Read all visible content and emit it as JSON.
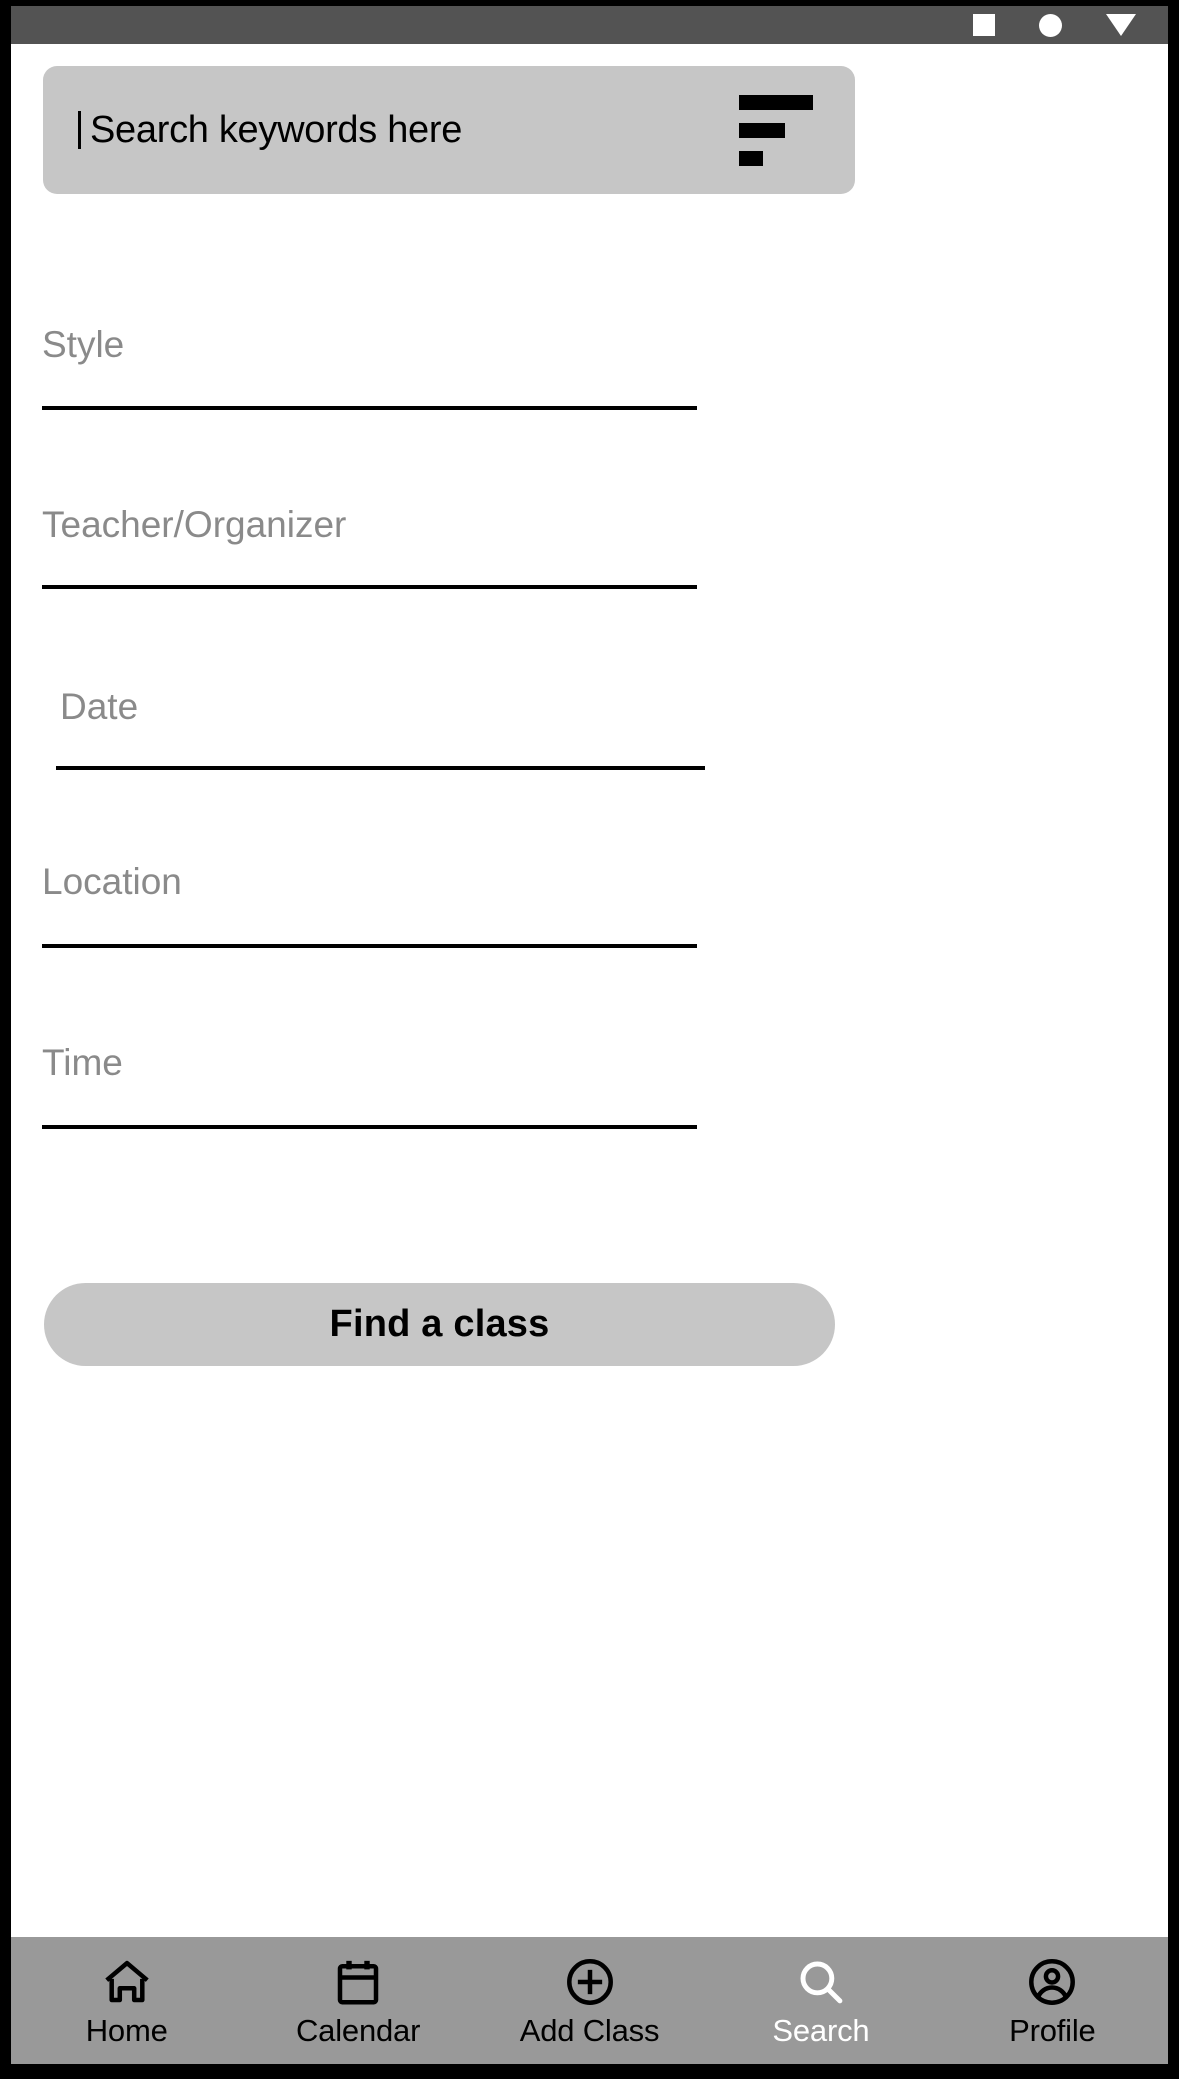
{
  "status_bar": {
    "icons": [
      {
        "name": "square-icon",
        "glyph": "square"
      },
      {
        "name": "circle-icon",
        "glyph": "circle"
      },
      {
        "name": "triangle-down-icon",
        "glyph": "triangle-down"
      }
    ],
    "background_color": "#535353",
    "icon_color": "#ffffff"
  },
  "search": {
    "placeholder": "Search keywords here",
    "value": "",
    "caret_visible": true,
    "filter_icon": "filter-lines-icon",
    "background_color": "#c6c6c6"
  },
  "form": {
    "fields": [
      {
        "id": "style",
        "label": "Style",
        "value": ""
      },
      {
        "id": "teacher",
        "label": "Teacher/Organizer",
        "value": ""
      },
      {
        "id": "date",
        "label": "Date",
        "value": ""
      },
      {
        "id": "location",
        "label": "Location",
        "value": ""
      },
      {
        "id": "time",
        "label": "Time",
        "value": ""
      }
    ],
    "label_color": "#8a8a8a",
    "rule_color": "#000000"
  },
  "primary_button": {
    "label": "Find a class",
    "background_color": "#c6c6c6",
    "text_color": "#000000"
  },
  "bottom_nav": {
    "background_color": "#999999",
    "active_color": "#ffffff",
    "inactive_color": "#000000",
    "items": [
      {
        "label": "Home",
        "icon": "home-icon",
        "active": false
      },
      {
        "label": "Calendar",
        "icon": "calendar-icon",
        "active": false
      },
      {
        "label": "Add Class",
        "icon": "plus-circle-icon",
        "active": false
      },
      {
        "label": "Search",
        "icon": "magnifier-icon",
        "active": true
      },
      {
        "label": "Profile",
        "icon": "account-circle-icon",
        "active": false
      }
    ]
  }
}
